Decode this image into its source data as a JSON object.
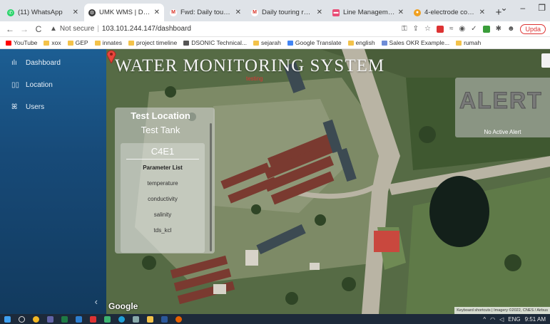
{
  "browser": {
    "tabs": [
      {
        "title": "(11) WhatsApp",
        "icon": "whatsapp-icon",
        "color": "#25d366",
        "active": false
      },
      {
        "title": "UMK WMS | Dashboard",
        "icon": "site-icon",
        "color": "#3a3a3a",
        "active": true
      },
      {
        "title": "Fwd: Daily touring report",
        "icon": "gmail-icon",
        "color": "#d93025",
        "active": false
      },
      {
        "title": "Daily touring report fo",
        "icon": "gmail-icon",
        "color": "#d93025",
        "active": false
      },
      {
        "title": "Line Management - X",
        "icon": "doc-icon",
        "color": "#e94e77",
        "active": false
      },
      {
        "title": "4-electrode conductivity",
        "icon": "site-icon",
        "color": "#f0a020",
        "active": false
      }
    ],
    "new_tab": "+",
    "window_controls": [
      "⌄",
      "–",
      "❐"
    ],
    "address": {
      "security": "Not secure",
      "url": "103.101.244.147/dashboard"
    },
    "update_label": "Upda",
    "bookmarks": [
      {
        "label": "YouTube",
        "color": "#ff0000"
      },
      {
        "label": "xox",
        "color": "#f3c24a"
      },
      {
        "label": "GEP",
        "color": "#f3c24a"
      },
      {
        "label": "innates",
        "color": "#f3c24a"
      },
      {
        "label": "project timeline",
        "color": "#f3c24a"
      },
      {
        "label": "DSONIC Technical...",
        "color": "#555555"
      },
      {
        "label": "sejarah",
        "color": "#f3c24a"
      },
      {
        "label": "Google Translate",
        "color": "#4285f4"
      },
      {
        "label": "english",
        "color": "#f3c24a"
      },
      {
        "label": "Sales OKR Example...",
        "color": "#6e8cd6"
      },
      {
        "label": "rumah",
        "color": "#f3c24a"
      }
    ]
  },
  "sidebar": {
    "items": [
      {
        "label": "Dashboard",
        "icon": "bar-chart-icon"
      },
      {
        "label": "Location",
        "icon": "book-icon"
      },
      {
        "label": "Users",
        "icon": "users-icon"
      }
    ],
    "collapse": "‹"
  },
  "main": {
    "title": "WATER MONITORING SYSTEM",
    "pin_label": "testing",
    "location_panel": {
      "title": "Test Location",
      "subtitle": "Test Tank",
      "sensor": "C4E1",
      "parameter_title": "Parameter List",
      "parameters": [
        "temperature",
        "conductivity",
        "salinity",
        "tds_kcl"
      ]
    },
    "alert": {
      "title": "ALERT",
      "message": "No Active Alert"
    },
    "map": {
      "logo": "Google",
      "attribution": "Keyboard shortcuts | Imagery ©2022, CNES / Airbus"
    }
  },
  "taskbar": {
    "clock": "9:51 AM",
    "lang": "ENG"
  }
}
